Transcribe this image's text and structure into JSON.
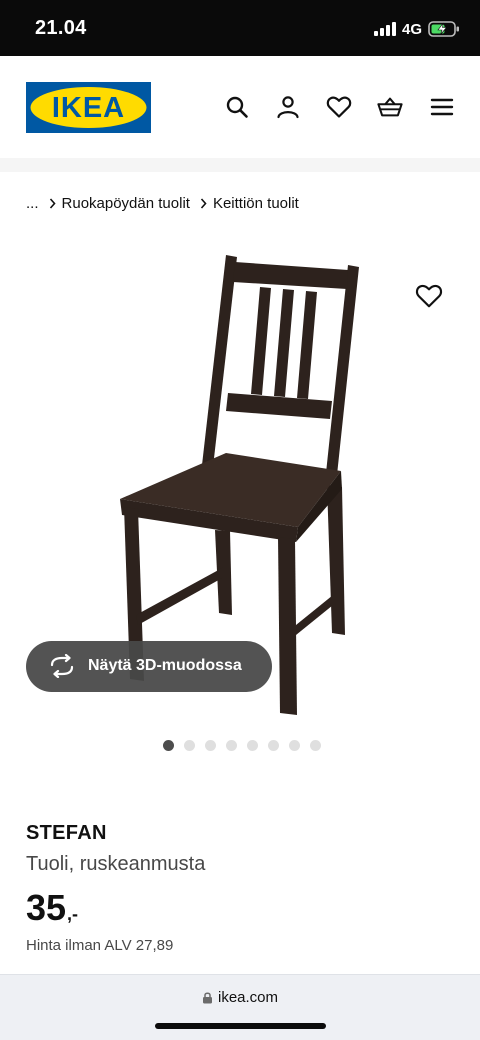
{
  "status_bar": {
    "time": "21.04",
    "network": "4G"
  },
  "header": {
    "logo_text": "IKEA",
    "logo_colors": {
      "background": "#0058A3",
      "oval": "#FFDB00"
    },
    "icons": [
      "search-icon",
      "account-icon",
      "heart-icon",
      "basket-icon",
      "menu-icon"
    ]
  },
  "breadcrumb": {
    "items": [
      "...",
      "Ruokapöydän tuolit",
      "Keittiön tuolit"
    ]
  },
  "gallery": {
    "view_3d_label": "Näytä 3D-muodossa",
    "image_count": 8,
    "active_index": 0
  },
  "product": {
    "name": "STEFAN",
    "description": "Tuoli, ruskeanmusta",
    "price_integer": "35",
    "price_decimal": ",-",
    "price_excl_vat": "Hinta ilman ALV 27,89"
  },
  "browser": {
    "url": "ikea.com"
  },
  "colors": {
    "chair_wood": "#2d221d",
    "status_bar_bg": "#0a0a0a",
    "view3d_bg": "#484848"
  }
}
